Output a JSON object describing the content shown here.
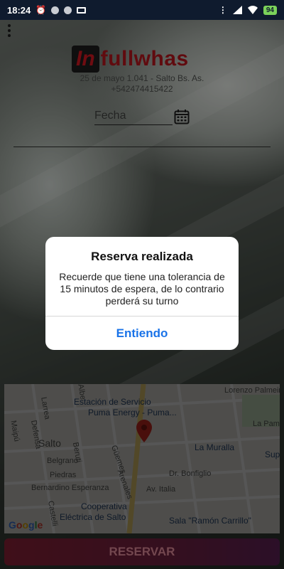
{
  "status_bar": {
    "time": "18:24",
    "battery": "94"
  },
  "header": {
    "logo_prefix": "In",
    "logo_suffix": "fullwhas",
    "address": "25 de mayo 1.041 - Salto Bs. As.",
    "phone": "+542474415422"
  },
  "form": {
    "date_placeholder": "Fecha"
  },
  "map": {
    "poi_station_line1": "Estación de Servicio",
    "poi_station_line2": "Puma Energy - Puma...",
    "poi_muralla": "La Muralla",
    "poi_super": "Sup",
    "poi_coop_line1": "Cooperativa",
    "poi_coop_line2": "Eléctrica de Salto",
    "poi_sala": "Sala \"Ramón Carrillo\"",
    "label_salto": "Salto",
    "label_belgrano": "Belgrano",
    "label_piedras": "Piedras",
    "label_bernardino": "Bernardino Esperanza",
    "label_bonfiglio": "Dr. Bonfiglio",
    "label_italia": "Av. Italia",
    "label_palmeiro": "Lorenzo Palmeiro",
    "label_lapampa": "La Pampa",
    "label_defensa": "Defensa",
    "label_maipu": "Maipú",
    "label_beruti": "Beruti",
    "label_guemes": "Güemes",
    "label_arenales": "Arenales",
    "label_larrea": "Larrea",
    "label_castelli": "Castelli",
    "label_alberdi": "Albe",
    "google": "Google"
  },
  "buttons": {
    "reserve": "RESERVAR"
  },
  "dialog": {
    "title": "Reserva realizada",
    "message": "Recuerde que tiene una tolerancia de 15 minutos de espera, de lo contrario perderá su turno",
    "button": "Entiendo"
  }
}
